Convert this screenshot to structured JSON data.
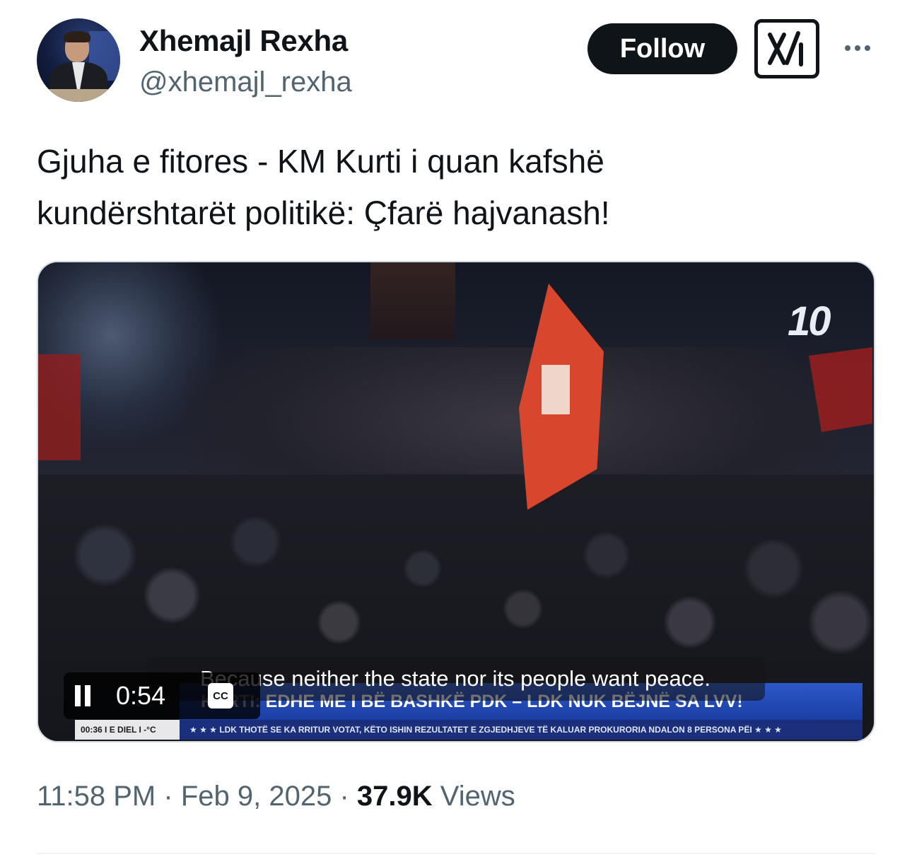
{
  "author": {
    "name": "Xhemajl Rexha",
    "handle": "@xhemajl_rexha"
  },
  "actions": {
    "follow_label": "Follow",
    "grok_icon": "grok-icon",
    "more_icon": "more-horizontal-icon"
  },
  "tweet": {
    "text_line1": "Gjuha e fitores - KM Kurti i quan kafshë",
    "text_line2": "kundërshtarët politikë: Çfarë hajvanash!"
  },
  "video": {
    "time": "0:54",
    "cc_label": "CC",
    "caption": "Because neither the state nor its people want peace.",
    "ticker_main": "KURTI: EDHE ME I BË BASHKË PDK – LDK NUK BËJNË SA LVV!",
    "ticker_sub": "★ ★ ★ LDK THOTË SE KA RRITUR VOTAT, KËTO ISHIN REZULTATET E ZGJEDHJEVE TË KALUAR PROKURORIA NDALON 8 PERSONA PËI ★ ★ ★",
    "ticker_clock": "00:36 I E DIEL I -°C",
    "channel_logo": "10"
  },
  "meta": {
    "time": "11:58 PM",
    "date": "Feb 9, 2025",
    "views_count": "37.9K",
    "views_label": "Views",
    "separator": "·"
  },
  "colors": {
    "text_primary": "#0f1419",
    "text_secondary": "#536471",
    "follow_bg": "#0f1419",
    "ticker_blue": "#1b3ea3"
  }
}
